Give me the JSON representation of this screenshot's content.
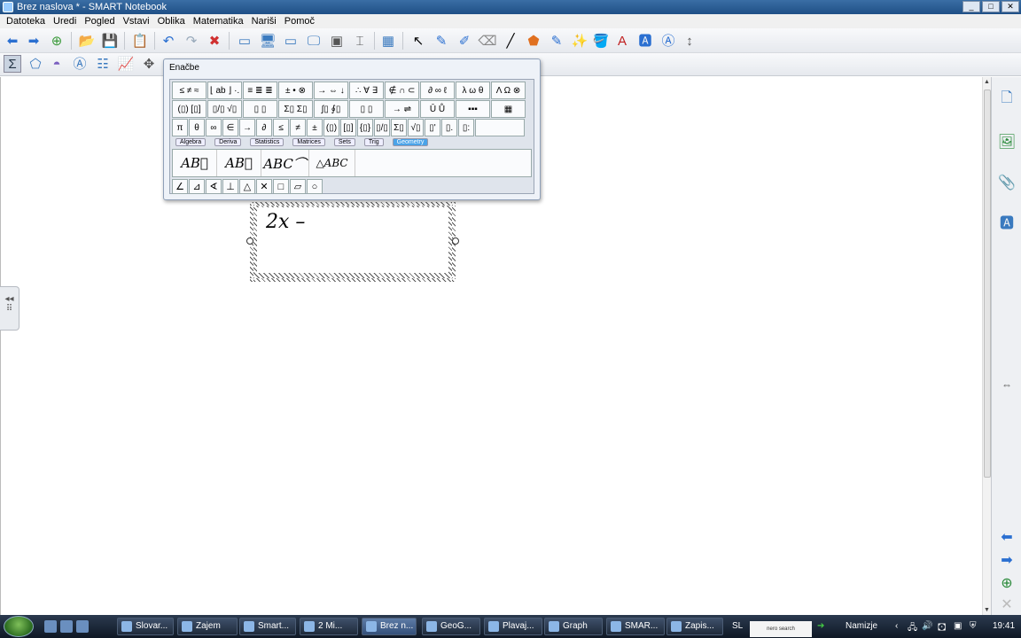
{
  "window": {
    "title": "Brez naslova * - SMART Notebook",
    "buttons": [
      "_",
      "□",
      "✕"
    ]
  },
  "menu": [
    "Datoteka",
    "Uredi",
    "Pogled",
    "Vstavi",
    "Oblika",
    "Matematika",
    "Nariši",
    "Pomoč"
  ],
  "equation_editor": {
    "title": "Enačbe",
    "row1": [
      "≤ ≠ ≈",
      "⌊ ab ⌋ ·.",
      "≡ ≣ ≣",
      "± • ⊗",
      "→ ⇔ ↓",
      "∴ ∀ ∃",
      "∉ ∩ ⊂",
      "∂ ∞ ℓ",
      "λ ω θ",
      "Λ Ω ⊗"
    ],
    "row2": [
      "(▯) [▯]",
      "▯/▯ √▯",
      "▯ ▯",
      "Σ▯ Σ▯",
      "∫▯ ∮▯",
      "▯ ▯",
      "→ ⇌",
      "Ū Ů",
      "▪▪▪",
      "▦"
    ],
    "row3": [
      "π",
      "θ",
      "∞",
      "∈",
      "→",
      "∂",
      "≤",
      "≠",
      "±",
      "(▯)",
      "[▯]",
      "{▯}",
      "▯/▯",
      "Σ▯",
      "√▯",
      "▯'",
      "▯.",
      "▯:"
    ],
    "tabs": [
      "Algebra",
      "Deriva",
      "Statistics",
      "Matrices",
      "Sets",
      "Trig",
      "Geometry"
    ],
    "active_tab": "Geometry",
    "templates": [
      "AB⃗",
      "AB⃡",
      "ABC⌒",
      "△ABC"
    ],
    "geometry_symbols": [
      "∠",
      "⊿",
      "∢",
      "⊥",
      "△",
      "✕",
      "□",
      "▱",
      "○"
    ]
  },
  "math_object": {
    "expression": "2x –"
  },
  "taskbar": {
    "tasks": [
      {
        "label": "Slovar..."
      },
      {
        "label": "Zajem"
      },
      {
        "label": "Smart..."
      },
      {
        "label": "2 Mi..."
      },
      {
        "label": "Brez n..."
      },
      {
        "label": "GeoG..."
      },
      {
        "label": "Plavaj..."
      },
      {
        "label": "Graph"
      },
      {
        "label": "SMAR..."
      },
      {
        "label": "Zapis..."
      }
    ],
    "tray": {
      "language": "SL",
      "nero": "nero search",
      "desktop": "Namizje",
      "clock": "19:41"
    }
  },
  "colors": {
    "accent": "#4aa3e8",
    "titlebar": "#1f4f86"
  }
}
